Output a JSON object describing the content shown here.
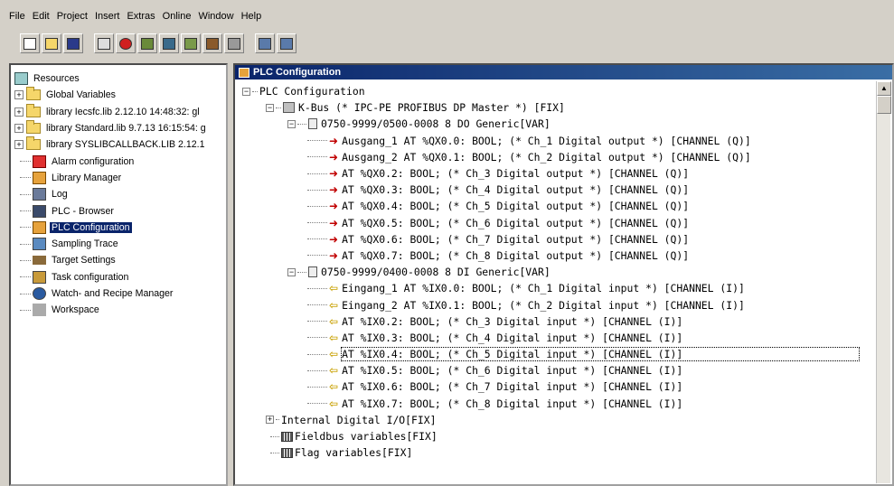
{
  "menu": [
    "File",
    "Edit",
    "Project",
    "Insert",
    "Extras",
    "Online",
    "Window",
    "Help"
  ],
  "toolbar": {
    "buttons": [
      "new-icon",
      "open-icon",
      "save-icon",
      "compile-icon",
      "stop-icon",
      "login-icon",
      "logout-icon",
      "run-icon",
      "reset-icon",
      "print-icon",
      "find-icon",
      "replace-icon"
    ]
  },
  "resources": {
    "root": "Resources",
    "items": [
      {
        "label": "Global Variables",
        "kind": "folder",
        "expandable": true
      },
      {
        "label": "library Iecsfc.lib 2.12.10 14:48:32: gl",
        "kind": "folder",
        "expandable": true
      },
      {
        "label": "library Standard.lib 9.7.13 16:15:54: g",
        "kind": "folder",
        "expandable": true
      },
      {
        "label": "library SYSLIBCALLBACK.LIB 2.12.1",
        "kind": "folder",
        "expandable": true
      },
      {
        "label": "Alarm configuration",
        "kind": "alarm"
      },
      {
        "label": "Library Manager",
        "kind": "library"
      },
      {
        "label": "Log",
        "kind": "log"
      },
      {
        "label": "PLC - Browser",
        "kind": "browser"
      },
      {
        "label": "PLC Configuration",
        "kind": "plc",
        "selected": true
      },
      {
        "label": "Sampling Trace",
        "kind": "trace"
      },
      {
        "label": "Target Settings",
        "kind": "target"
      },
      {
        "label": "Task configuration",
        "kind": "task"
      },
      {
        "label": "Watch- and Recipe Manager",
        "kind": "watch"
      },
      {
        "label": "Workspace",
        "kind": "workspace"
      }
    ]
  },
  "window": {
    "title": "PLC Configuration"
  },
  "config": {
    "root": "PLC Configuration",
    "kbus": "K-Bus (* IPC-PE PROFIBUS DP Master *) [FIX]",
    "do_module": "0750-9999/0500-0008 8 DO Generic[VAR]",
    "outputs": [
      "Ausgang_1 AT %QX0.0: BOOL; (* Ch_1 Digital output *) [CHANNEL (Q)]",
      "Ausgang_2 AT %QX0.1: BOOL; (* Ch_2 Digital output *) [CHANNEL (Q)]",
      "AT %QX0.2: BOOL; (* Ch_3 Digital output *) [CHANNEL (Q)]",
      "AT %QX0.3: BOOL; (* Ch_4 Digital output *) [CHANNEL (Q)]",
      "AT %QX0.4: BOOL; (* Ch_5 Digital output *) [CHANNEL (Q)]",
      "AT %QX0.5: BOOL; (* Ch_6 Digital output *) [CHANNEL (Q)]",
      "AT %QX0.6: BOOL; (* Ch_7 Digital output *) [CHANNEL (Q)]",
      "AT %QX0.7: BOOL; (* Ch_8 Digital output *) [CHANNEL (Q)]"
    ],
    "di_module": "0750-9999/0400-0008 8 DI Generic[VAR]",
    "inputs": [
      "Eingang_1 AT %IX0.0: BOOL; (* Ch_1 Digital input *) [CHANNEL (I)]",
      "Eingang_2 AT %IX0.1: BOOL; (* Ch_2 Digital input *) [CHANNEL (I)]",
      "AT %IX0.2: BOOL; (* Ch_3 Digital input *) [CHANNEL (I)]",
      "AT %IX0.3: BOOL; (* Ch_4 Digital input *) [CHANNEL (I)]",
      "AT %IX0.4: BOOL; (* Ch_5 Digital input *) [CHANNEL (I)]",
      "AT %IX0.5: BOOL; (* Ch_6 Digital input *) [CHANNEL (I)]",
      "AT %IX0.6: BOOL; (* Ch_7 Digital input *) [CHANNEL (I)]",
      "AT %IX0.7: BOOL; (* Ch_8 Digital input *) [CHANNEL (I)]"
    ],
    "focused_input_index": 4,
    "internal": "Internal Digital I/O[FIX]",
    "fieldbus": "Fieldbus variables[FIX]",
    "flags": "Flag variables[FIX]"
  },
  "colors": {
    "selection": "#0a246a",
    "output_arrow": "#c00000",
    "input_arrow": "#c8a000"
  }
}
